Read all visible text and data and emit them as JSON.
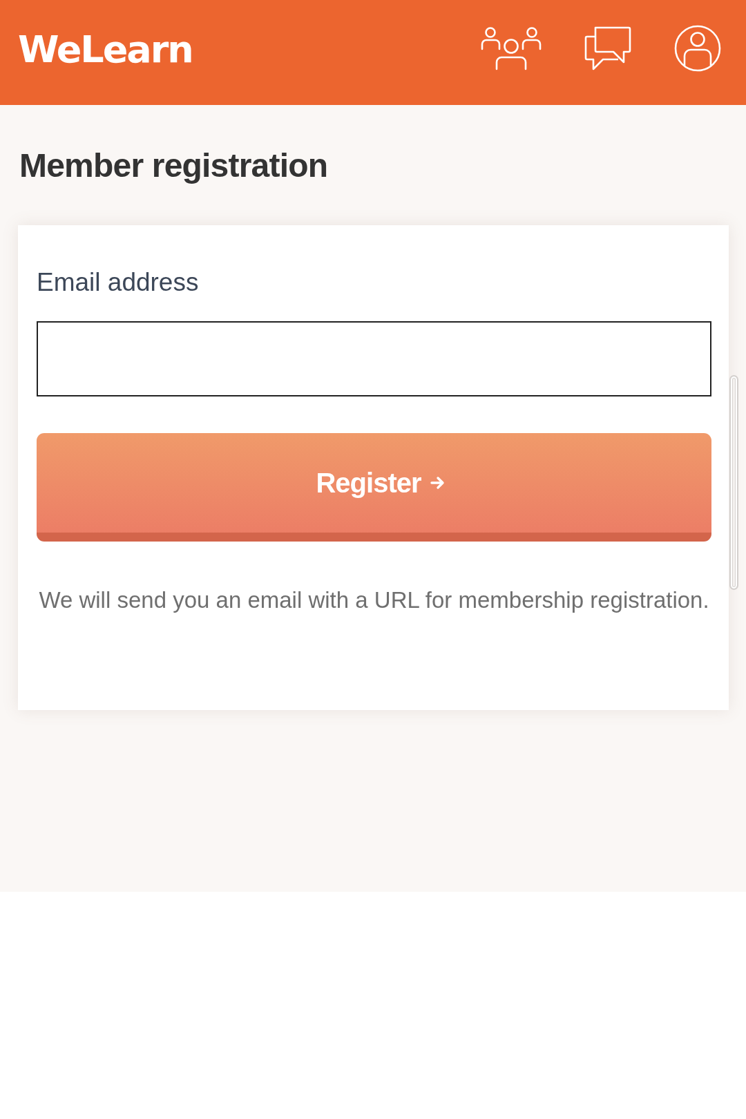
{
  "header": {
    "logo": "WeLearn"
  },
  "page": {
    "title": "Member registration"
  },
  "form": {
    "fields": [
      {
        "label": "Email address"
      }
    ],
    "submit": {
      "label": "Register"
    },
    "note": "We will send you an email with a URL for membership registration."
  }
}
